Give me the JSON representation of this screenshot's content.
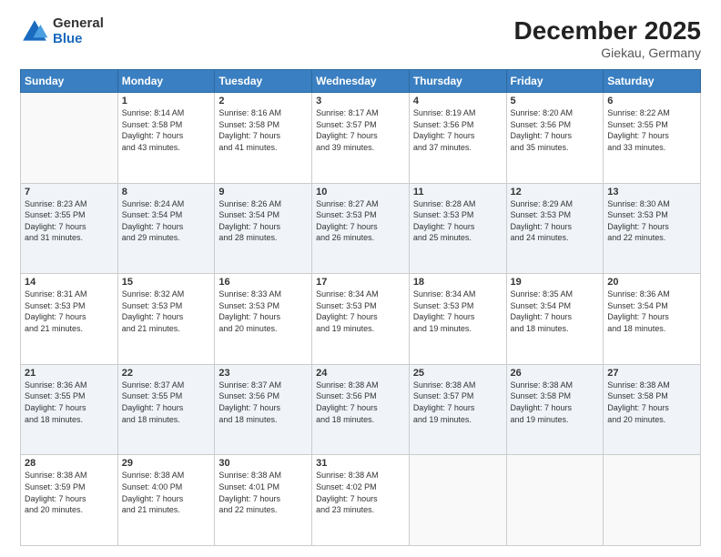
{
  "logo": {
    "general": "General",
    "blue": "Blue"
  },
  "title": "December 2025",
  "location": "Giekau, Germany",
  "weekdays": [
    "Sunday",
    "Monday",
    "Tuesday",
    "Wednesday",
    "Thursday",
    "Friday",
    "Saturday"
  ],
  "weeks": [
    [
      {
        "day": "",
        "info": ""
      },
      {
        "day": "1",
        "info": "Sunrise: 8:14 AM\nSunset: 3:58 PM\nDaylight: 7 hours\nand 43 minutes."
      },
      {
        "day": "2",
        "info": "Sunrise: 8:16 AM\nSunset: 3:58 PM\nDaylight: 7 hours\nand 41 minutes."
      },
      {
        "day": "3",
        "info": "Sunrise: 8:17 AM\nSunset: 3:57 PM\nDaylight: 7 hours\nand 39 minutes."
      },
      {
        "day": "4",
        "info": "Sunrise: 8:19 AM\nSunset: 3:56 PM\nDaylight: 7 hours\nand 37 minutes."
      },
      {
        "day": "5",
        "info": "Sunrise: 8:20 AM\nSunset: 3:56 PM\nDaylight: 7 hours\nand 35 minutes."
      },
      {
        "day": "6",
        "info": "Sunrise: 8:22 AM\nSunset: 3:55 PM\nDaylight: 7 hours\nand 33 minutes."
      }
    ],
    [
      {
        "day": "7",
        "info": "Sunrise: 8:23 AM\nSunset: 3:55 PM\nDaylight: 7 hours\nand 31 minutes."
      },
      {
        "day": "8",
        "info": "Sunrise: 8:24 AM\nSunset: 3:54 PM\nDaylight: 7 hours\nand 29 minutes."
      },
      {
        "day": "9",
        "info": "Sunrise: 8:26 AM\nSunset: 3:54 PM\nDaylight: 7 hours\nand 28 minutes."
      },
      {
        "day": "10",
        "info": "Sunrise: 8:27 AM\nSunset: 3:53 PM\nDaylight: 7 hours\nand 26 minutes."
      },
      {
        "day": "11",
        "info": "Sunrise: 8:28 AM\nSunset: 3:53 PM\nDaylight: 7 hours\nand 25 minutes."
      },
      {
        "day": "12",
        "info": "Sunrise: 8:29 AM\nSunset: 3:53 PM\nDaylight: 7 hours\nand 24 minutes."
      },
      {
        "day": "13",
        "info": "Sunrise: 8:30 AM\nSunset: 3:53 PM\nDaylight: 7 hours\nand 22 minutes."
      }
    ],
    [
      {
        "day": "14",
        "info": "Sunrise: 8:31 AM\nSunset: 3:53 PM\nDaylight: 7 hours\nand 21 minutes."
      },
      {
        "day": "15",
        "info": "Sunrise: 8:32 AM\nSunset: 3:53 PM\nDaylight: 7 hours\nand 21 minutes."
      },
      {
        "day": "16",
        "info": "Sunrise: 8:33 AM\nSunset: 3:53 PM\nDaylight: 7 hours\nand 20 minutes."
      },
      {
        "day": "17",
        "info": "Sunrise: 8:34 AM\nSunset: 3:53 PM\nDaylight: 7 hours\nand 19 minutes."
      },
      {
        "day": "18",
        "info": "Sunrise: 8:34 AM\nSunset: 3:53 PM\nDaylight: 7 hours\nand 19 minutes."
      },
      {
        "day": "19",
        "info": "Sunrise: 8:35 AM\nSunset: 3:54 PM\nDaylight: 7 hours\nand 18 minutes."
      },
      {
        "day": "20",
        "info": "Sunrise: 8:36 AM\nSunset: 3:54 PM\nDaylight: 7 hours\nand 18 minutes."
      }
    ],
    [
      {
        "day": "21",
        "info": "Sunrise: 8:36 AM\nSunset: 3:55 PM\nDaylight: 7 hours\nand 18 minutes."
      },
      {
        "day": "22",
        "info": "Sunrise: 8:37 AM\nSunset: 3:55 PM\nDaylight: 7 hours\nand 18 minutes."
      },
      {
        "day": "23",
        "info": "Sunrise: 8:37 AM\nSunset: 3:56 PM\nDaylight: 7 hours\nand 18 minutes."
      },
      {
        "day": "24",
        "info": "Sunrise: 8:38 AM\nSunset: 3:56 PM\nDaylight: 7 hours\nand 18 minutes."
      },
      {
        "day": "25",
        "info": "Sunrise: 8:38 AM\nSunset: 3:57 PM\nDaylight: 7 hours\nand 19 minutes."
      },
      {
        "day": "26",
        "info": "Sunrise: 8:38 AM\nSunset: 3:58 PM\nDaylight: 7 hours\nand 19 minutes."
      },
      {
        "day": "27",
        "info": "Sunrise: 8:38 AM\nSunset: 3:58 PM\nDaylight: 7 hours\nand 20 minutes."
      }
    ],
    [
      {
        "day": "28",
        "info": "Sunrise: 8:38 AM\nSunset: 3:59 PM\nDaylight: 7 hours\nand 20 minutes."
      },
      {
        "day": "29",
        "info": "Sunrise: 8:38 AM\nSunset: 4:00 PM\nDaylight: 7 hours\nand 21 minutes."
      },
      {
        "day": "30",
        "info": "Sunrise: 8:38 AM\nSunset: 4:01 PM\nDaylight: 7 hours\nand 22 minutes."
      },
      {
        "day": "31",
        "info": "Sunrise: 8:38 AM\nSunset: 4:02 PM\nDaylight: 7 hours\nand 23 minutes."
      },
      {
        "day": "",
        "info": ""
      },
      {
        "day": "",
        "info": ""
      },
      {
        "day": "",
        "info": ""
      }
    ]
  ]
}
